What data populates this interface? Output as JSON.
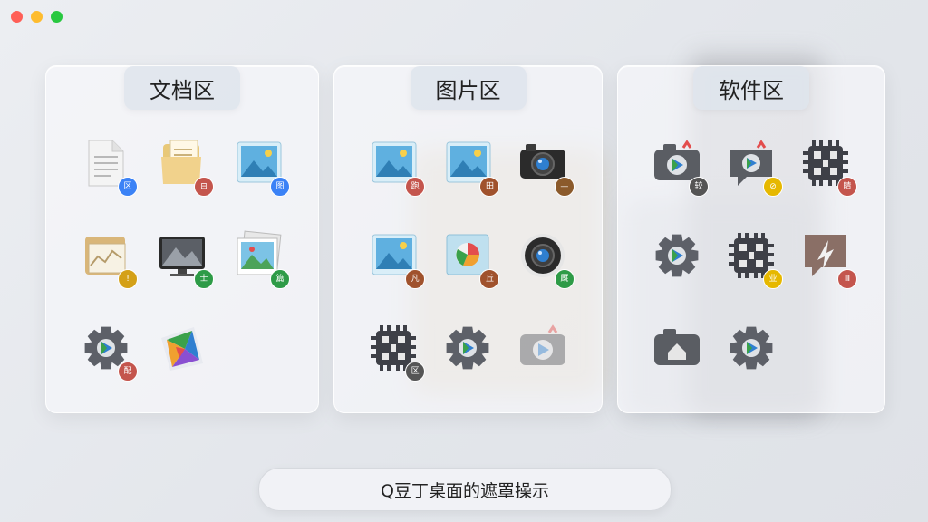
{
  "window": {
    "controls": [
      {
        "name": "close",
        "color": "#ff5f57"
      },
      {
        "name": "minimize",
        "color": "#febc2e"
      },
      {
        "name": "zoom",
        "color": "#28c840"
      }
    ]
  },
  "panels": [
    {
      "title": "文档区",
      "items": [
        {
          "icon": "text-document-icon",
          "badge": "区",
          "badge_color": "#3b82f6"
        },
        {
          "icon": "folder-document-icon",
          "badge": "⊟",
          "badge_color": "#c4554d"
        },
        {
          "icon": "landscape-image-icon",
          "badge": "图",
          "badge_color": "#3b82f6"
        },
        {
          "icon": "chart-folder-icon",
          "badge": "!",
          "badge_color": "#d4a017"
        },
        {
          "icon": "monitor-icon",
          "badge": "士",
          "badge_color": "#2e9b47"
        },
        {
          "icon": "photo-stack-icon",
          "badge": "篇",
          "badge_color": "#2e9b47"
        },
        {
          "icon": "settings-gear-icon",
          "badge": "配",
          "badge_color": "#c4554d"
        },
        {
          "icon": "color-prism-icon",
          "badge": "",
          "badge_color": ""
        }
      ]
    },
    {
      "title": "图片区",
      "items": [
        {
          "icon": "landscape-image-icon",
          "badge": "跑",
          "badge_color": "#c4554d"
        },
        {
          "icon": "landscape-image-icon",
          "badge": "田",
          "badge_color": "#a0522d"
        },
        {
          "icon": "camera-icon",
          "badge": "—",
          "badge_color": "#8b5a2b"
        },
        {
          "icon": "landscape-image-icon",
          "badge": "凡",
          "badge_color": "#a0522d"
        },
        {
          "icon": "pie-chart-image-icon",
          "badge": "丘",
          "badge_color": "#a0522d"
        },
        {
          "icon": "camera-lens-icon",
          "badge": "厩",
          "badge_color": "#2e9b47"
        },
        {
          "icon": "chip-icon",
          "badge": "区",
          "badge_color": "#555"
        },
        {
          "icon": "settings-gear-icon",
          "badge": "",
          "badge_color": ""
        },
        {
          "icon": "camera-app-icon-faded",
          "badge": "",
          "badge_color": ""
        }
      ]
    },
    {
      "title": "软件区",
      "items": [
        {
          "icon": "camera-app-icon",
          "badge": "较",
          "badge_color": "#555"
        },
        {
          "icon": "chat-app-icon",
          "badge": "⊘",
          "badge_color": "#e6b800"
        },
        {
          "icon": "chip-icon",
          "badge": "睛",
          "badge_color": "#c4554d"
        },
        {
          "icon": "settings-gear-icon",
          "badge": "",
          "badge_color": ""
        },
        {
          "icon": "chip-icon",
          "badge": "业",
          "badge_color": "#e6b800"
        },
        {
          "icon": "message-app-icon",
          "badge": "Ⅲ",
          "badge_color": "#c4554d"
        },
        {
          "icon": "home-camera-icon",
          "badge": "",
          "badge_color": ""
        },
        {
          "icon": "settings-gear-icon",
          "badge": "",
          "badge_color": ""
        }
      ]
    }
  ],
  "bottom_bar": {
    "label": "Q豆丁桌面的遮罩操示"
  }
}
